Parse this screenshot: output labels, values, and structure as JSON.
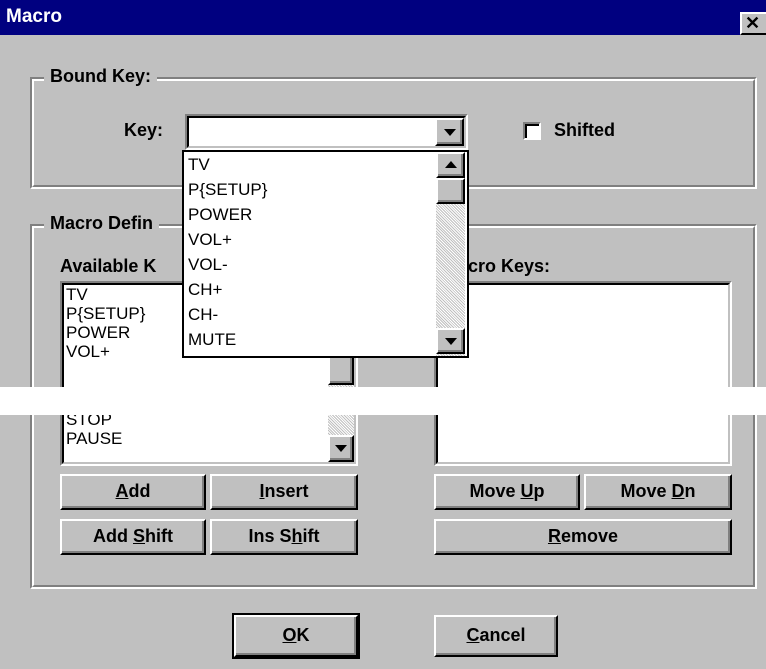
{
  "window": {
    "title": "Macro",
    "close_glyph": "✕"
  },
  "bound_key": {
    "legend": "Bound Key:",
    "key_label": "Key:",
    "key_value": "",
    "shifted_label": "Shifted",
    "shifted_checked": false
  },
  "dropdown_list": {
    "items": [
      "TV",
      "P{SETUP}",
      "POWER",
      "VOL+",
      "VOL-",
      "CH+",
      "CH-",
      "MUTE"
    ]
  },
  "macro_def": {
    "legend": "Macro Defin",
    "available_label": "Available K",
    "macro_keys_label": "cro Keys:",
    "available_items_top": [
      "TV",
      "P{SETUP}",
      "POWER",
      "VOL+"
    ],
    "available_items_bottom": [
      "STOP",
      "PAUSE"
    ],
    "macro_keys_items": []
  },
  "buttons": {
    "add": {
      "pre": "",
      "u": "A",
      "post": "dd"
    },
    "insert": {
      "pre": "",
      "u": "I",
      "post": "nsert"
    },
    "add_shift": {
      "pre": "Add ",
      "u": "S",
      "post": "hift"
    },
    "ins_shift": {
      "pre": "Ins S",
      "u": "h",
      "post": "ift"
    },
    "move_up": {
      "pre": "Move ",
      "u": "U",
      "post": "p"
    },
    "move_dn": {
      "pre": "Move ",
      "u": "D",
      "post": "n"
    },
    "remove": {
      "pre": "",
      "u": "R",
      "post": "emove"
    },
    "ok": {
      "pre": "",
      "u": "O",
      "post": "K"
    },
    "cancel": {
      "pre": "",
      "u": "C",
      "post": "ancel"
    }
  },
  "colors": {
    "face": "#c0c0c0",
    "title_bar": "#000080",
    "title_text": "#ffffff"
  }
}
